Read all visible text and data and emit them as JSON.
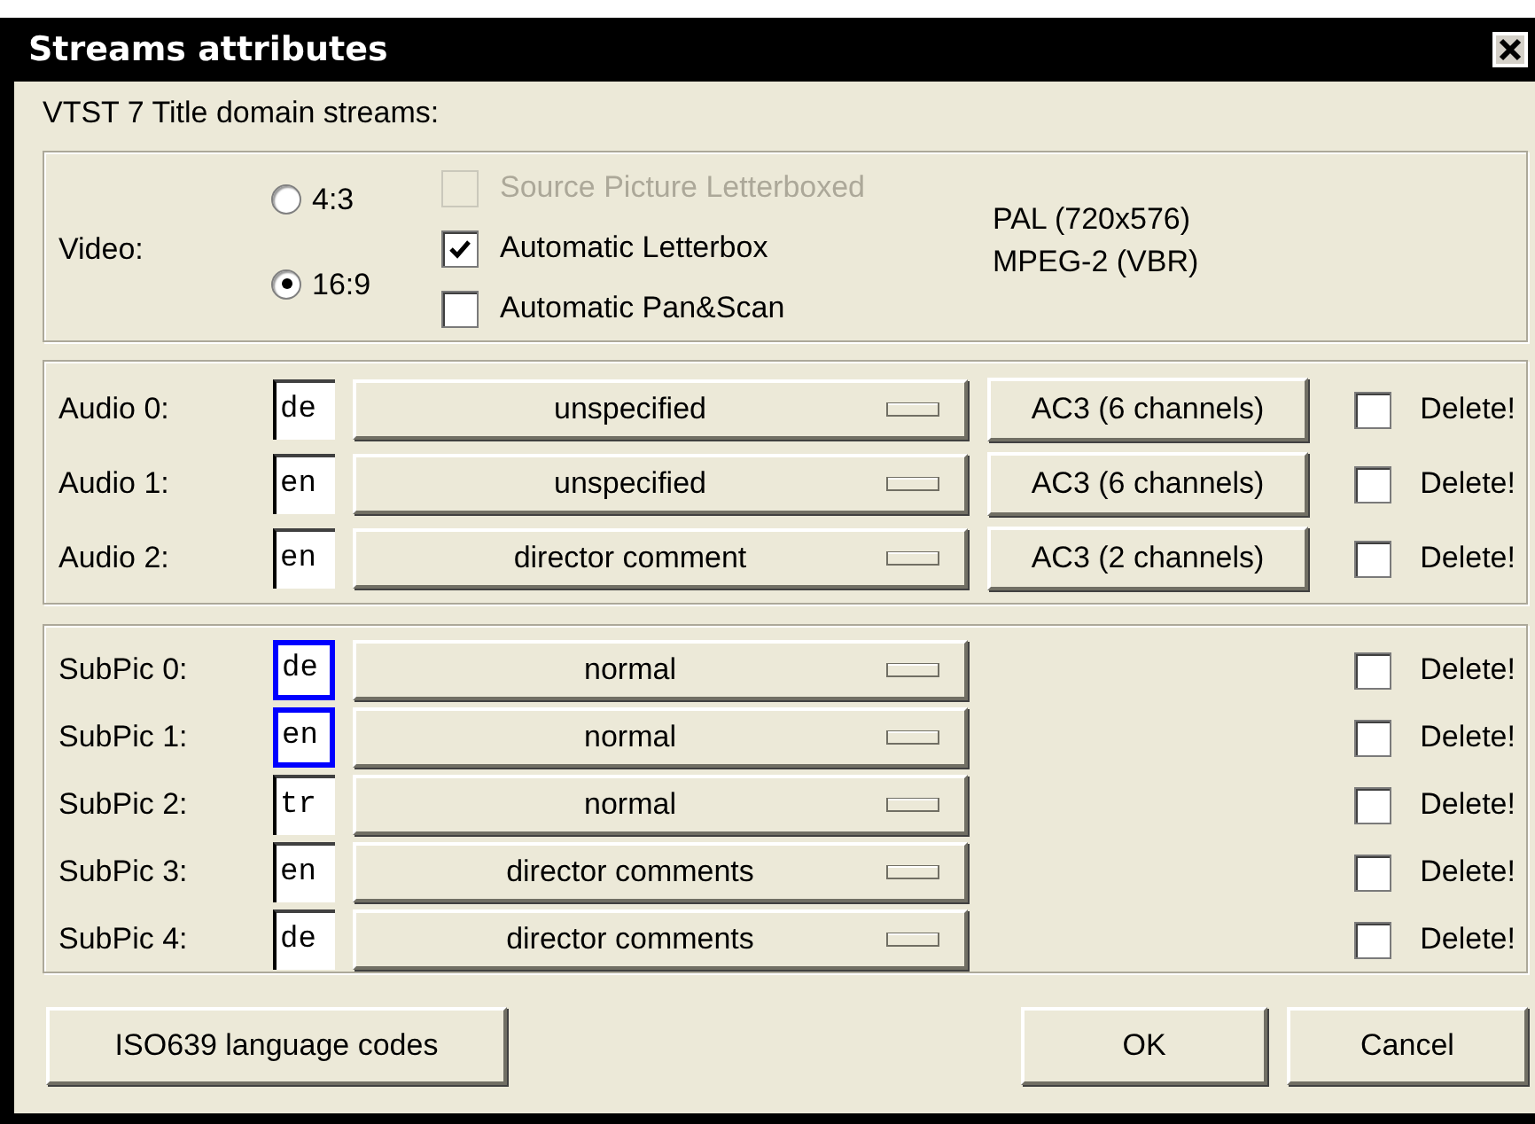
{
  "window": {
    "title": "Streams attributes"
  },
  "heading": "VTST 7 Title domain streams:",
  "video": {
    "label": "Video:",
    "aspect_ratios": [
      {
        "label": "4:3",
        "selected": false
      },
      {
        "label": "16:9",
        "selected": true
      }
    ],
    "options": [
      {
        "label": "Source Picture Letterboxed",
        "checked": false,
        "disabled": true
      },
      {
        "label": "Automatic Letterbox",
        "checked": true,
        "disabled": false
      },
      {
        "label": "Automatic Pan&Scan",
        "checked": false,
        "disabled": false
      }
    ],
    "info": [
      "PAL (720x576)",
      "MPEG-2 (VBR)"
    ]
  },
  "audio": [
    {
      "label": "Audio 0:",
      "language": "de",
      "focused": false,
      "mode": "unspecified",
      "format": "AC3 (6 channels)",
      "delete_label": "Delete!",
      "delete": false
    },
    {
      "label": "Audio 1:",
      "language": "en",
      "focused": false,
      "mode": "unspecified",
      "format": "AC3 (6 channels)",
      "delete_label": "Delete!",
      "delete": false
    },
    {
      "label": "Audio 2:",
      "language": "en",
      "focused": false,
      "mode": "director comment",
      "format": "AC3 (2 channels)",
      "delete_label": "Delete!",
      "delete": false
    }
  ],
  "subpictures": [
    {
      "label": "SubPic 0:",
      "language": "de",
      "focused": true,
      "mode": "normal",
      "delete_label": "Delete!",
      "delete": false
    },
    {
      "label": "SubPic 1:",
      "language": "en",
      "focused": true,
      "mode": "normal",
      "delete_label": "Delete!",
      "delete": false
    },
    {
      "label": "SubPic 2:",
      "language": "tr",
      "focused": false,
      "mode": "normal",
      "delete_label": "Delete!",
      "delete": false
    },
    {
      "label": "SubPic 3:",
      "language": "en",
      "focused": false,
      "mode": "director comments",
      "delete_label": "Delete!",
      "delete": false
    },
    {
      "label": "SubPic 4:",
      "language": "de",
      "focused": false,
      "mode": "director comments",
      "delete_label": "Delete!",
      "delete": false
    }
  ],
  "footer": {
    "left_button": "ISO639 language codes",
    "buttons": [
      "OK",
      "Cancel"
    ]
  }
}
